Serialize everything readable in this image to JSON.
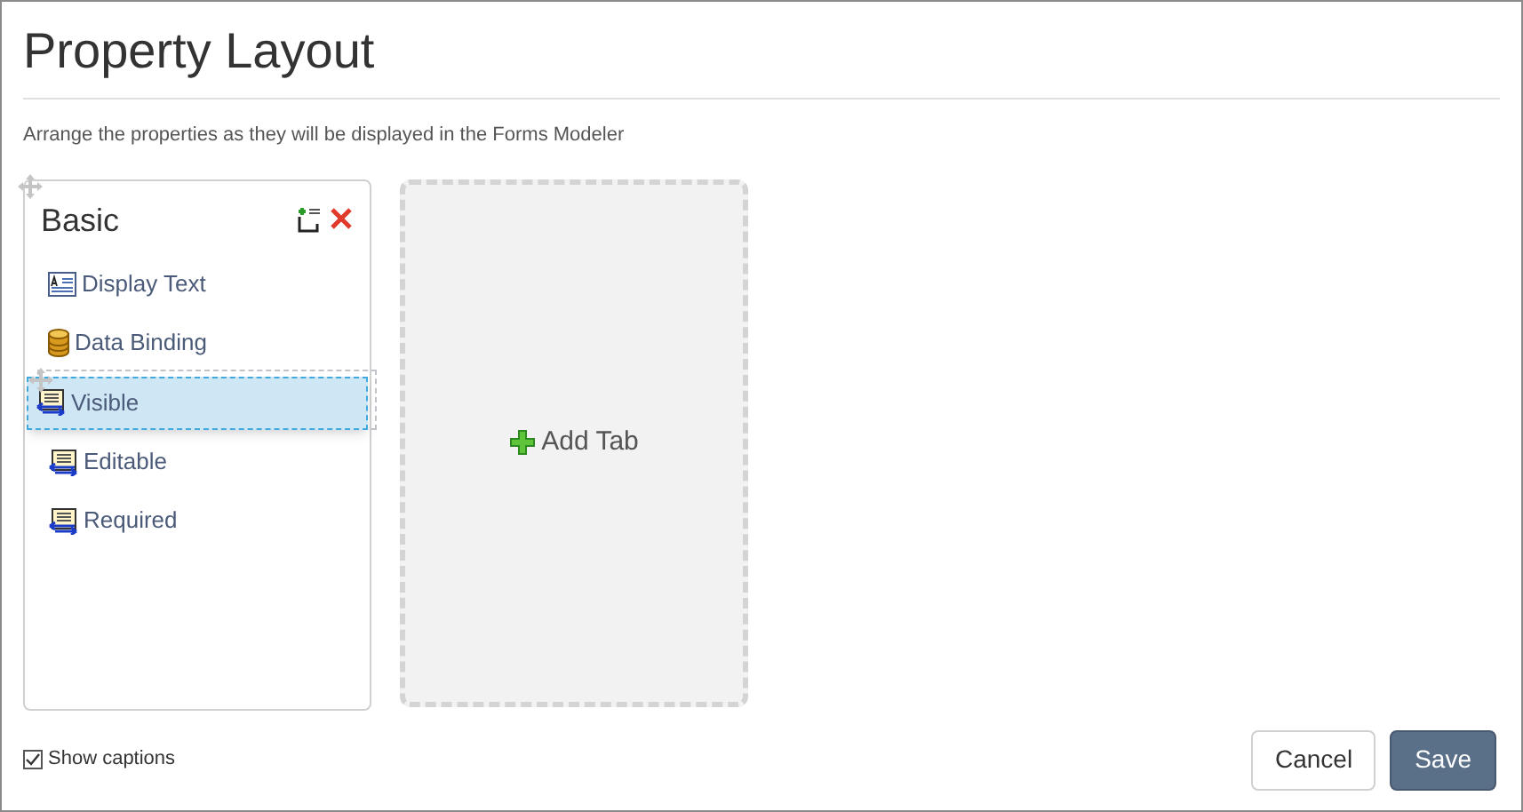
{
  "title": "Property Layout",
  "subtitle": "Arrange the properties as they will be displayed in the Forms Modeler",
  "tabs": [
    {
      "title": "Basic",
      "properties": [
        {
          "label": "Display Text",
          "kind": "text",
          "selected": false
        },
        {
          "label": "Data Binding",
          "kind": "database",
          "selected": false
        },
        {
          "label": "Visible",
          "kind": "field",
          "selected": true
        },
        {
          "label": "Editable",
          "kind": "field",
          "selected": false
        },
        {
          "label": "Required",
          "kind": "field",
          "selected": false
        }
      ]
    }
  ],
  "add_tab": "Add Tab",
  "show_captions": {
    "label": "Show captions",
    "checked": true
  },
  "buttons": [
    {
      "label": "Cancel",
      "kind": "secondary"
    },
    {
      "label": "Save",
      "kind": "primary"
    }
  ]
}
